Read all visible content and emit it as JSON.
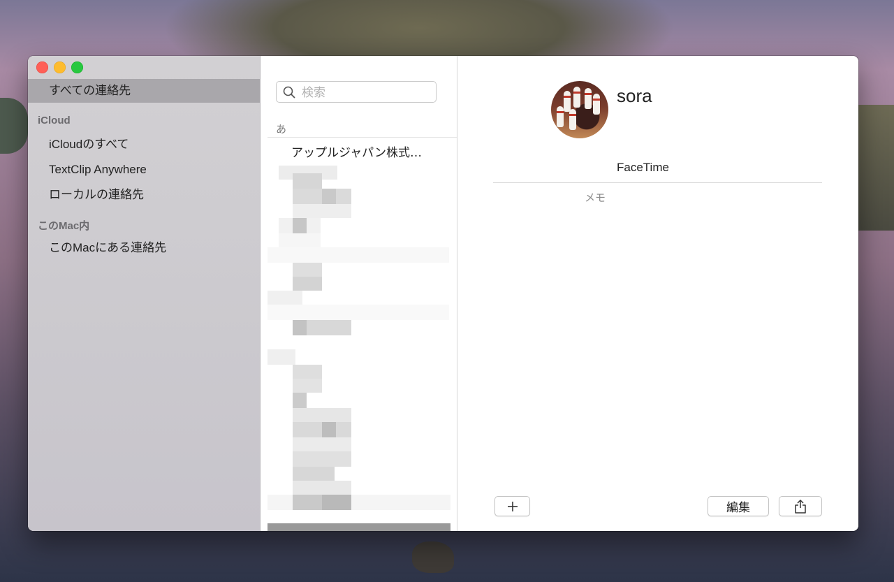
{
  "sidebar": {
    "all_contacts": "すべての連絡先",
    "groups": [
      {
        "header": "iCloud",
        "items": [
          "iCloudのすべて",
          "TextClip Anywhere",
          "ローカルの連絡先"
        ]
      },
      {
        "header": "このMac内",
        "items": [
          "このMacにある連絡先"
        ]
      }
    ]
  },
  "list": {
    "search_placeholder": "検索",
    "section": "あ",
    "first_contact": "アップルジャパン株式…"
  },
  "detail": {
    "name": "sora",
    "facetime": "FaceTime",
    "memo_label": "メモ",
    "add_label": "+",
    "edit_label": "編集"
  },
  "colors": {
    "sidebar_selected": "#a9a7ab",
    "close": "#ff5f57",
    "minimize": "#febc2e",
    "maximize": "#28c840"
  },
  "icons": [
    "search-icon",
    "share-icon",
    "plus-icon"
  ]
}
